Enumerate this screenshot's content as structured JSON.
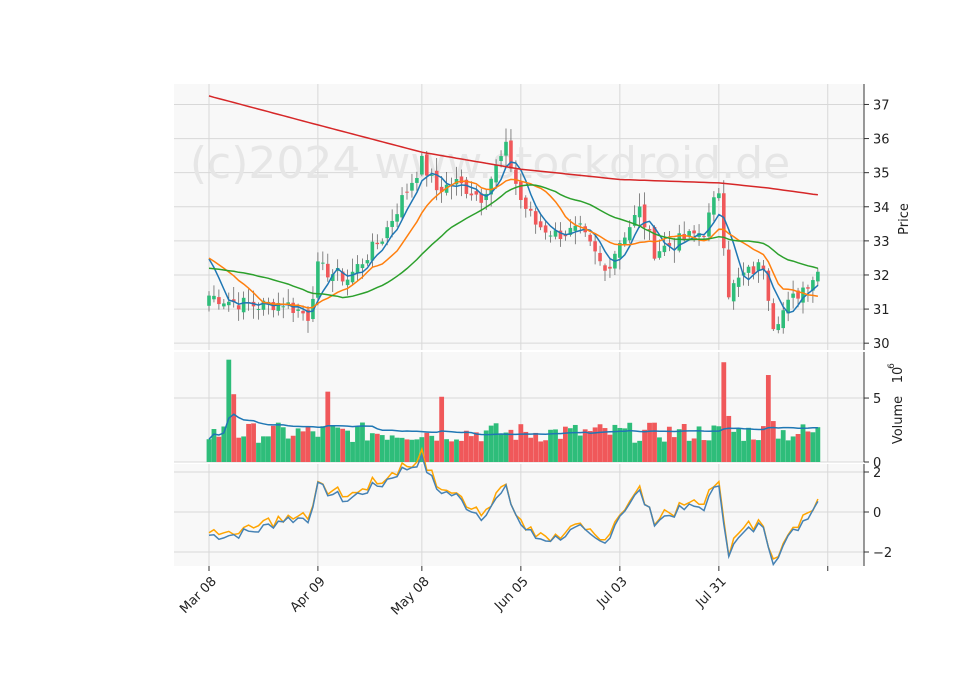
{
  "watermark": "(c)2024 www.stockdroid.de",
  "colors": {
    "up": "#2ebd7a",
    "down": "#f0585a",
    "ma_fast": "#1f77b4",
    "ma_mid": "#ff7f0e",
    "ma_slow": "#2ca02c",
    "ma_long": "#d62728",
    "osc_main": "#4682b4",
    "osc_signal": "#ffa500",
    "panel_bg": "#f8f8f8",
    "grid": "#d8d8d8"
  },
  "chart_data": {
    "type": "candlestick",
    "x_tick_labels": [
      "Mar 08",
      "Apr 09",
      "May 08",
      "Jun 05",
      "Jul 03",
      "Jul 31"
    ],
    "x_tick_index": [
      0,
      22,
      43,
      63,
      83,
      103,
      125
    ],
    "price_axis": {
      "label": "Price",
      "ylim": [
        29.8,
        37.6
      ],
      "ticks": [
        30,
        31,
        32,
        33,
        34,
        35,
        36,
        37
      ]
    },
    "volume_axis": {
      "label": "Volume",
      "exponent": "10",
      "exponent_power": "6",
      "ylim": [
        0,
        8.6
      ],
      "ticks": [
        0,
        5
      ]
    },
    "osc_axis": {
      "ylim": [
        -2.7,
        2.4
      ],
      "ticks": [
        -2,
        0,
        2
      ]
    },
    "key_prices": [
      {
        "i": 0,
        "close": 31.4
      },
      {
        "i": 5,
        "close": 31.2
      },
      {
        "i": 10,
        "close": 31.1
      },
      {
        "i": 15,
        "close": 31.2
      },
      {
        "i": 20,
        "close": 30.8
      },
      {
        "i": 22,
        "close": 32.2
      },
      {
        "i": 28,
        "close": 31.9
      },
      {
        "i": 35,
        "close": 33.1
      },
      {
        "i": 40,
        "close": 34.5
      },
      {
        "i": 43,
        "close": 35.3
      },
      {
        "i": 46,
        "close": 34.5
      },
      {
        "i": 50,
        "close": 34.7
      },
      {
        "i": 55,
        "close": 34.3
      },
      {
        "i": 60,
        "close": 35.7
      },
      {
        "i": 63,
        "close": 34.2
      },
      {
        "i": 66,
        "close": 33.5
      },
      {
        "i": 70,
        "close": 33.2
      },
      {
        "i": 75,
        "close": 33.3
      },
      {
        "i": 80,
        "close": 32.1
      },
      {
        "i": 83,
        "close": 33.0
      },
      {
        "i": 87,
        "close": 33.9
      },
      {
        "i": 90,
        "close": 32.7
      },
      {
        "i": 95,
        "close": 33.0
      },
      {
        "i": 100,
        "close": 33.3
      },
      {
        "i": 103,
        "close": 34.5
      },
      {
        "i": 105,
        "close": 31.5
      },
      {
        "i": 108,
        "close": 32.0
      },
      {
        "i": 112,
        "close": 32.3
      },
      {
        "i": 114,
        "close": 30.6
      },
      {
        "i": 118,
        "close": 31.3
      },
      {
        "i": 121,
        "close": 31.8
      },
      {
        "i": 123,
        "close": 32.1
      }
    ],
    "vol_spikes": [
      {
        "i": 4,
        "v": 8.0
      },
      {
        "i": 5,
        "v": 5.3
      },
      {
        "i": 24,
        "v": 5.5
      },
      {
        "i": 47,
        "v": 5.1
      },
      {
        "i": 104,
        "v": 7.8
      },
      {
        "i": 105,
        "v": 3.6
      },
      {
        "i": 113,
        "v": 6.8
      },
      {
        "i": 114,
        "v": 3.2
      }
    ],
    "ma_long_points": [
      {
        "i": 0,
        "v": 37.25
      },
      {
        "i": 22,
        "v": 36.4
      },
      {
        "i": 43,
        "v": 35.6
      },
      {
        "i": 63,
        "v": 35.1
      },
      {
        "i": 83,
        "v": 34.8
      },
      {
        "i": 103,
        "v": 34.7
      },
      {
        "i": 113,
        "v": 34.55
      },
      {
        "i": 123,
        "v": 34.35
      }
    ],
    "series_names": []
  }
}
